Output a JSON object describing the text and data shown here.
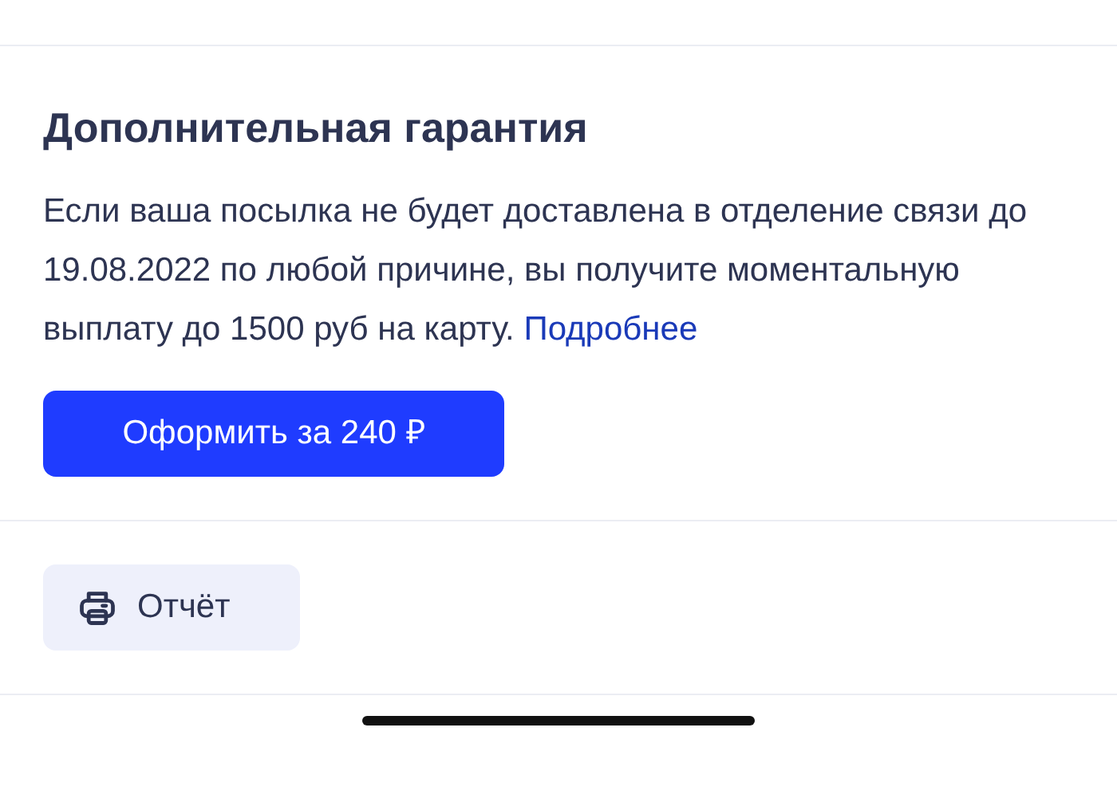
{
  "section": {
    "title": "Дополнительная гарантия",
    "text": "Если ваша посылка не будет доставлена в отделение связи до 19.08.2022 по любой причине, вы получите моментальную выплату до 1500 руб на карту.",
    "link": "Подробнее",
    "button": "Оформить за 240 ₽"
  },
  "report_button": "Отчёт"
}
